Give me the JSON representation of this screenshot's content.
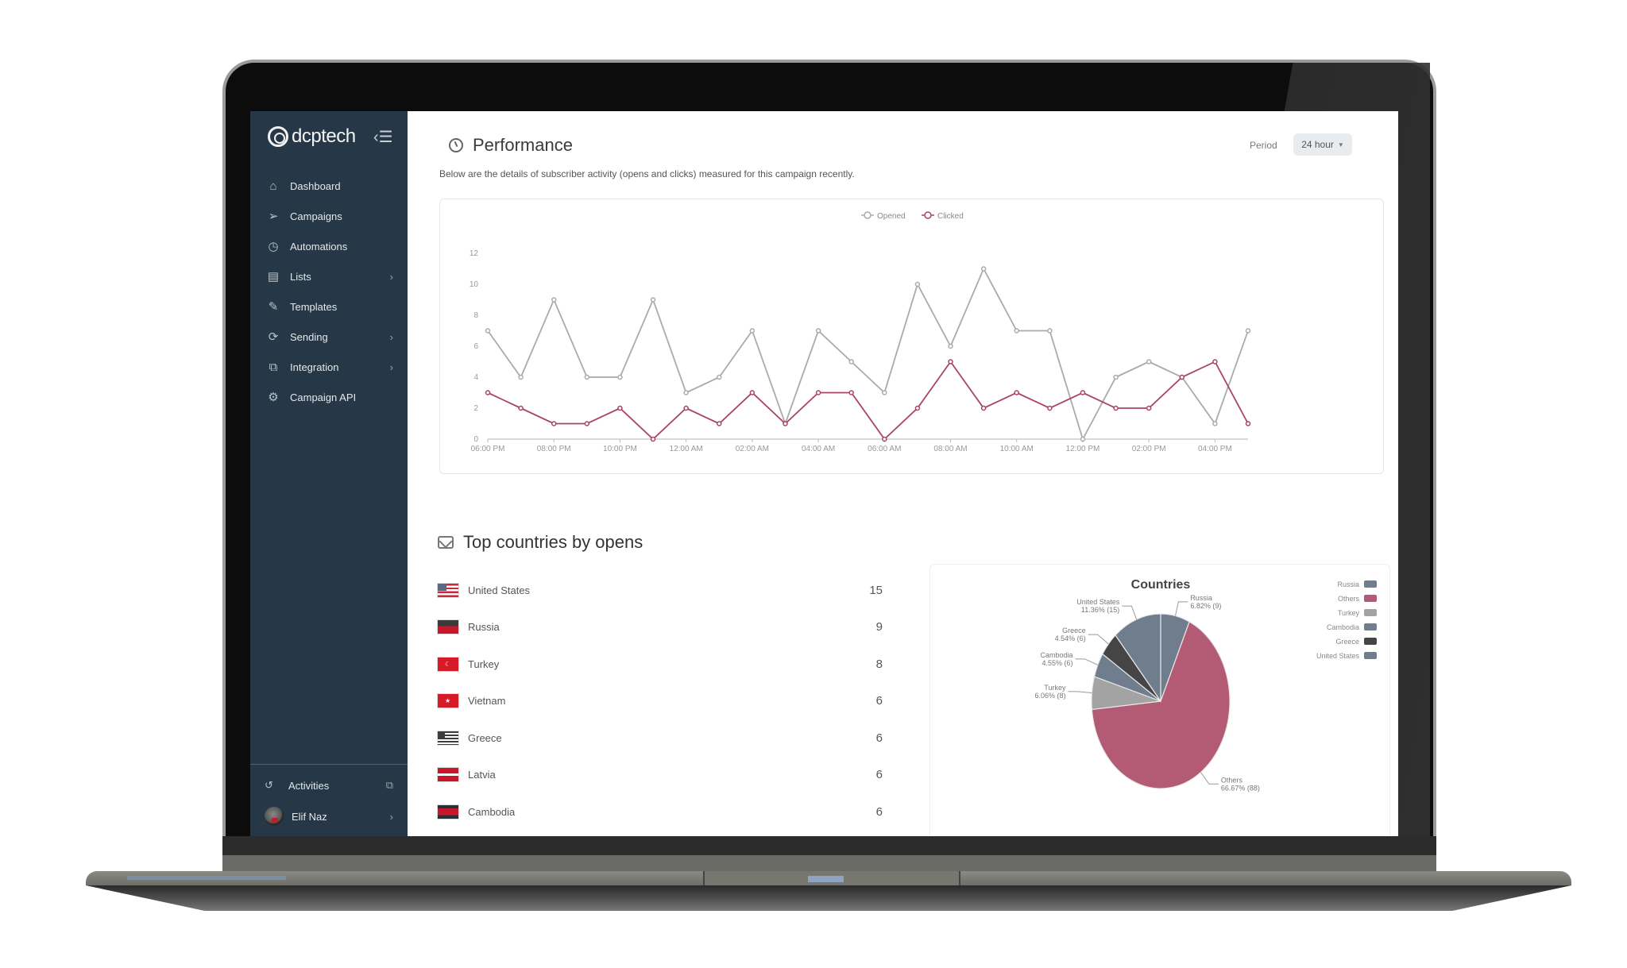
{
  "sidebar": {
    "brand": "dcptech",
    "items": [
      {
        "label": "Dashboard",
        "icon": "home-icon",
        "has_children": false
      },
      {
        "label": "Campaigns",
        "icon": "send-icon",
        "has_children": false
      },
      {
        "label": "Automations",
        "icon": "alarm-icon",
        "has_children": false
      },
      {
        "label": "Lists",
        "icon": "list-icon",
        "has_children": true
      },
      {
        "label": "Templates",
        "icon": "edit-icon",
        "has_children": false
      },
      {
        "label": "Sending",
        "icon": "sync-icon",
        "has_children": true
      },
      {
        "label": "Integration",
        "icon": "integration-icon",
        "has_children": true
      },
      {
        "label": "Campaign API",
        "icon": "gear-icon",
        "has_children": false
      }
    ],
    "activities_label": "Activities",
    "user_name": "Elif Naz"
  },
  "performance": {
    "title": "Performance",
    "description": "Below are the details of subscriber activity (opens and clicks) measured for this campaign recently.",
    "period_label": "Period",
    "period_value": "24 hour"
  },
  "countries": {
    "title": "Top countries by opens",
    "rows": [
      {
        "name": "United States",
        "value": "15",
        "flag": "us"
      },
      {
        "name": "Russia",
        "value": "9",
        "flag": "ru"
      },
      {
        "name": "Turkey",
        "value": "8",
        "flag": "tr"
      },
      {
        "name": "Vietnam",
        "value": "6",
        "flag": "vn"
      },
      {
        "name": "Greece",
        "value": "6",
        "flag": "gr"
      },
      {
        "name": "Latvia",
        "value": "6",
        "flag": "lv"
      },
      {
        "name": "Cambodia",
        "value": "6",
        "flag": "kh"
      }
    ]
  },
  "colors": {
    "opened": "#a8abad",
    "clicked": "#a8455f",
    "sidebar": "#263847"
  },
  "chart_data": [
    {
      "type": "line",
      "title": "",
      "xlabel": "",
      "ylabel": "",
      "ylim": [
        0,
        12
      ],
      "yticks": [
        "0",
        "2",
        "4",
        "6",
        "8",
        "10",
        "12"
      ],
      "x": [
        "06:00 PM",
        "07:00 PM",
        "08:00 PM",
        "09:00 PM",
        "10:00 PM",
        "11:00 PM",
        "12:00 AM",
        "01:00 AM",
        "02:00 AM",
        "03:00 AM",
        "04:00 AM",
        "05:00 AM",
        "06:00 AM",
        "07:00 AM",
        "08:00 AM",
        "09:00 AM",
        "10:00 AM",
        "11:00 AM",
        "12:00 PM",
        "01:00 PM",
        "02:00 PM",
        "03:00 PM",
        "04:00 PM",
        "05:00 PM"
      ],
      "xtick_labels": [
        "06:00 PM",
        "08:00 PM",
        "10:00 PM",
        "12:00 AM",
        "02:00 AM",
        "04:00 AM",
        "06:00 AM",
        "08:00 AM",
        "10:00 AM",
        "12:00 PM",
        "02:00 PM",
        "04:00 PM"
      ],
      "legend": "top-center",
      "series": [
        {
          "name": "Opened",
          "color": "#a8abad",
          "values": [
            7,
            4,
            9,
            4,
            4,
            9,
            3,
            4,
            7,
            1,
            7,
            5,
            3,
            10,
            6,
            11,
            7,
            7,
            0,
            4,
            5,
            4,
            1,
            7
          ]
        },
        {
          "name": "Clicked",
          "color": "#a8455f",
          "values": [
            3,
            2,
            1,
            1,
            2,
            0,
            2,
            1,
            3,
            1,
            3,
            3,
            0,
            2,
            5,
            2,
            3,
            2,
            3,
            2,
            2,
            4,
            5,
            1
          ]
        }
      ]
    },
    {
      "type": "pie",
      "title": "Countries",
      "legend": "top-right",
      "slices": [
        {
          "label": "Russia",
          "value": 9,
          "percent": "6.82%",
          "color": "#6f7d8c"
        },
        {
          "label": "Others",
          "value": 88,
          "percent": "66.67%",
          "color": "#b35a74"
        },
        {
          "label": "Turkey",
          "value": 8,
          "percent": "6.06%",
          "color": "#a3a3a3"
        },
        {
          "label": "Cambodia",
          "value": 6,
          "percent": "4.55%",
          "color": "#6f7d8c"
        },
        {
          "label": "Greece",
          "value": 6,
          "percent": "4.54%",
          "color": "#454545"
        },
        {
          "label": "United States",
          "value": 15,
          "percent": "11.36%",
          "color": "#6f7d8c"
        }
      ]
    }
  ]
}
